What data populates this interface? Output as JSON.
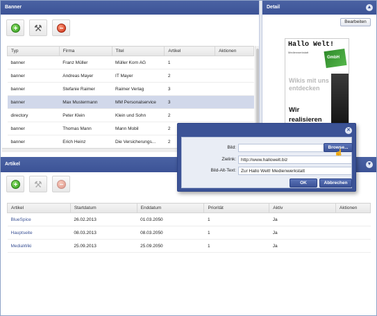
{
  "banner_panel": {
    "title": "Banner",
    "columns": [
      "Typ",
      "Firma",
      "Titel",
      "Artikel",
      "Aktionen"
    ],
    "rows": [
      [
        "banner",
        "Franz Müller",
        "Müller Korn AG",
        "1",
        ""
      ],
      [
        "banner",
        "Andreas Mayer",
        "IT Mayer",
        "2",
        ""
      ],
      [
        "banner",
        "Stefanie Raimer",
        "Raimer Verlag",
        "3",
        ""
      ],
      [
        "banner",
        "Max Mustermann",
        "MM Personalservice",
        "3",
        ""
      ],
      [
        "directory",
        "Peter Klein",
        "Klein und Sohn",
        "2",
        ""
      ],
      [
        "banner",
        "Thomas Mann",
        "Mann Mobil",
        "2",
        ""
      ],
      [
        "banner",
        "Erich Heinz",
        "Die Versicherungs...",
        "2",
        ""
      ]
    ],
    "selected_row": 3
  },
  "detail_panel": {
    "title": "Detail",
    "edit_label": "Bearbeiten",
    "ad": {
      "headline": "Hallo Welt!",
      "subline": "Medienwerkstatt",
      "badge": "GmbH",
      "grey_text": "Wikis mit uns entdecken",
      "black_text": "Wir realisieren und"
    }
  },
  "article_panel": {
    "title": "Artikel",
    "columns": [
      "Artikel",
      "Startdatum",
      "Enddatum",
      "Priorität",
      "Aktiv",
      "Aktionen"
    ],
    "rows": [
      [
        "BlueSpice",
        "26.02.2013",
        "01.03.2050",
        "1",
        "Ja",
        ""
      ],
      [
        "Hauptseite",
        "08.03.2013",
        "08.03.2050",
        "1",
        "Ja",
        ""
      ],
      [
        "MediaWiki",
        "25.09.2013",
        "25.09.2050",
        "1",
        "Ja",
        ""
      ]
    ]
  },
  "dialog": {
    "bild_label": "Bild:",
    "bild_value": "",
    "browse_label": "Browse...",
    "zielink_label": "Zielink:",
    "zielink_value": "http://www.hallowelt.biz",
    "alt_label": "Bild-Alt-Text:",
    "alt_value": "Zur Hallo Welt! Medienwerkstatt",
    "ok_label": "OK",
    "cancel_label": "Abbrechen"
  },
  "icons": [
    "plus-icon",
    "tools-icon",
    "minus-icon",
    "collapse-up-icon",
    "collapse-down-icon",
    "close-icon",
    "cursor-hand-icon"
  ],
  "colors": {
    "titlebar": "#3c5396",
    "selected_row": "#d1d8ea",
    "add": "#2c9a18",
    "delete": "#cc2a10",
    "link": "#3c5396"
  }
}
